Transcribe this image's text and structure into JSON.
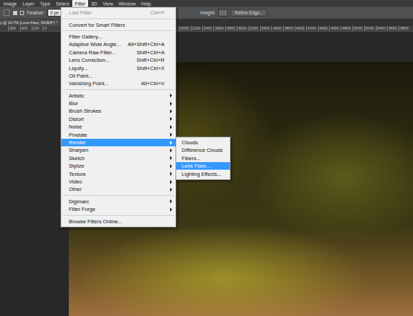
{
  "menu_bar": [
    {
      "label": "Image",
      "selected": false
    },
    {
      "label": "Layer",
      "selected": false
    },
    {
      "label": "Type",
      "selected": false
    },
    {
      "label": "Select",
      "selected": false
    },
    {
      "label": "Filter",
      "selected": true
    },
    {
      "label": "3D",
      "selected": false
    },
    {
      "label": "View",
      "selected": false
    },
    {
      "label": "Window",
      "selected": false
    },
    {
      "label": "Help",
      "selected": false
    }
  ],
  "options_bar": {
    "feather_label": "Feather:",
    "feather_value": "0 px",
    "height_label": "Height:",
    "refine_button": "Refine Edge..."
  },
  "document_tab": {
    "title": "y @ 16.7% (Lens Flare, RGB/8*) *"
  },
  "ruler": {
    "left_ticks": [
      "600",
      "400",
      "200",
      "0"
    ],
    "right_ticks": [
      "2000",
      "2200",
      "2400",
      "2600",
      "2800",
      "3000",
      "3200",
      "3400",
      "3600",
      "3800",
      "4000",
      "4200",
      "4400",
      "4600",
      "4800",
      "5000",
      "5200",
      "5400",
      "5600",
      "5800"
    ]
  },
  "filter_menu": {
    "items": [
      {
        "kind": "item",
        "label": "Last Filter",
        "shortcut": "Ctrl+F",
        "disabled": true,
        "selected": false,
        "submenu": false
      },
      {
        "kind": "separator"
      },
      {
        "kind": "item",
        "label": "Convert for Smart Filters",
        "shortcut": "",
        "disabled": false,
        "selected": false,
        "submenu": false
      },
      {
        "kind": "separator"
      },
      {
        "kind": "item",
        "label": "Filter Gallery...",
        "shortcut": "",
        "disabled": false,
        "selected": false,
        "submenu": false
      },
      {
        "kind": "item",
        "label": "Adaptive Wide Angle...",
        "shortcut": "Alt+Shift+Ctrl+A",
        "disabled": false,
        "selected": false,
        "submenu": false
      },
      {
        "kind": "item",
        "label": "Camera Raw Filter...",
        "shortcut": "Shift+Ctrl+A",
        "disabled": false,
        "selected": false,
        "submenu": false
      },
      {
        "kind": "item",
        "label": "Lens Correction...",
        "shortcut": "Shift+Ctrl+R",
        "disabled": false,
        "selected": false,
        "submenu": false
      },
      {
        "kind": "item",
        "label": "Liquify...",
        "shortcut": "Shift+Ctrl+X",
        "disabled": false,
        "selected": false,
        "submenu": false
      },
      {
        "kind": "item",
        "label": "Oil Paint...",
        "shortcut": "",
        "disabled": false,
        "selected": false,
        "submenu": false
      },
      {
        "kind": "item",
        "label": "Vanishing Point...",
        "shortcut": "Alt+Ctrl+V",
        "disabled": false,
        "selected": false,
        "submenu": false
      },
      {
        "kind": "separator"
      },
      {
        "kind": "item",
        "label": "Artistic",
        "shortcut": "",
        "disabled": false,
        "selected": false,
        "submenu": true
      },
      {
        "kind": "item",
        "label": "Blur",
        "shortcut": "",
        "disabled": false,
        "selected": false,
        "submenu": true
      },
      {
        "kind": "item",
        "label": "Brush Strokes",
        "shortcut": "",
        "disabled": false,
        "selected": false,
        "submenu": true
      },
      {
        "kind": "item",
        "label": "Distort",
        "shortcut": "",
        "disabled": false,
        "selected": false,
        "submenu": true
      },
      {
        "kind": "item",
        "label": "Noise",
        "shortcut": "",
        "disabled": false,
        "selected": false,
        "submenu": true
      },
      {
        "kind": "item",
        "label": "Pixelate",
        "shortcut": "",
        "disabled": false,
        "selected": false,
        "submenu": true
      },
      {
        "kind": "item",
        "label": "Render",
        "shortcut": "",
        "disabled": false,
        "selected": true,
        "submenu": true
      },
      {
        "kind": "item",
        "label": "Sharpen",
        "shortcut": "",
        "disabled": false,
        "selected": false,
        "submenu": true
      },
      {
        "kind": "item",
        "label": "Sketch",
        "shortcut": "",
        "disabled": false,
        "selected": false,
        "submenu": true
      },
      {
        "kind": "item",
        "label": "Stylize",
        "shortcut": "",
        "disabled": false,
        "selected": false,
        "submenu": true
      },
      {
        "kind": "item",
        "label": "Texture",
        "shortcut": "",
        "disabled": false,
        "selected": false,
        "submenu": true
      },
      {
        "kind": "item",
        "label": "Video",
        "shortcut": "",
        "disabled": false,
        "selected": false,
        "submenu": true
      },
      {
        "kind": "item",
        "label": "Other",
        "shortcut": "",
        "disabled": false,
        "selected": false,
        "submenu": true
      },
      {
        "kind": "separator"
      },
      {
        "kind": "item",
        "label": "Digimarc",
        "shortcut": "",
        "disabled": false,
        "selected": false,
        "submenu": true
      },
      {
        "kind": "item",
        "label": "Filter Forge",
        "shortcut": "",
        "disabled": false,
        "selected": false,
        "submenu": true
      },
      {
        "kind": "separator"
      },
      {
        "kind": "item",
        "label": "Browse Filters Online...",
        "shortcut": "",
        "disabled": false,
        "selected": false,
        "submenu": false
      }
    ]
  },
  "render_submenu": {
    "items": [
      {
        "label": "Clouds",
        "selected": false
      },
      {
        "label": "Difference Clouds",
        "selected": false
      },
      {
        "label": "Fibers...",
        "selected": false
      },
      {
        "label": "Lens Flare...",
        "selected": true
      },
      {
        "label": "Lighting Effects...",
        "selected": false
      }
    ]
  }
}
